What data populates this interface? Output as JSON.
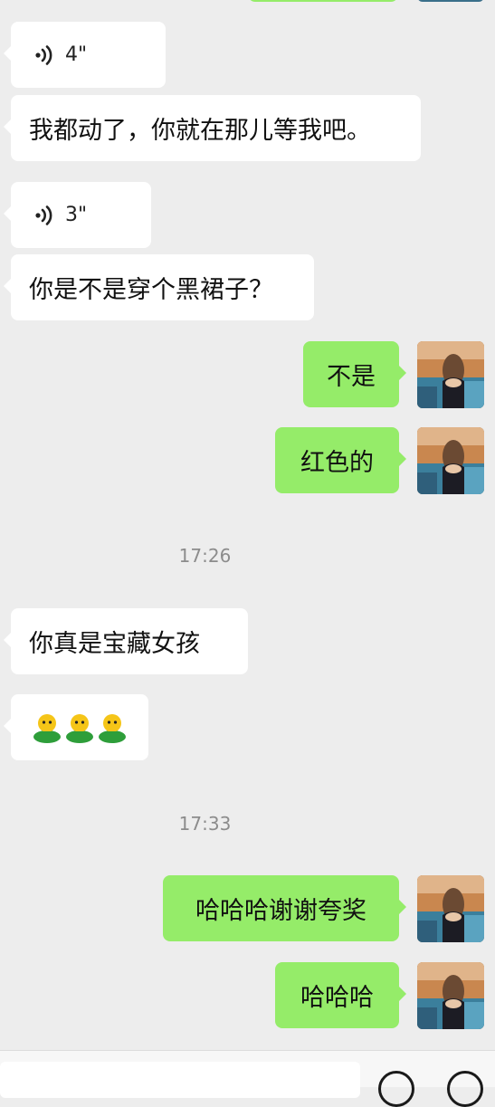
{
  "messages": [
    {
      "kind": "voice",
      "side": "in",
      "duration": "4\""
    },
    {
      "kind": "text",
      "side": "in",
      "text": "我都动了，你就在那儿等我吧。"
    },
    {
      "kind": "voice",
      "side": "in",
      "duration": "3\""
    },
    {
      "kind": "text",
      "side": "in",
      "text": "你是不是穿个黑裙子？"
    },
    {
      "kind": "text",
      "side": "out",
      "text": "不是"
    },
    {
      "kind": "text",
      "side": "out",
      "text": "红色的"
    },
    {
      "kind": "time",
      "text": "17:26"
    },
    {
      "kind": "text",
      "side": "in",
      "text": "你真是宝藏女孩"
    },
    {
      "kind": "emoji",
      "side": "in",
      "count": 3
    },
    {
      "kind": "time",
      "text": "17:33"
    },
    {
      "kind": "text",
      "side": "out",
      "text": "哈哈哈谢谢夸奖"
    },
    {
      "kind": "text",
      "side": "out",
      "text": "哈哈哈"
    }
  ],
  "colors": {
    "background": "#ededed",
    "incoming_bubble": "#ffffff",
    "outgoing_bubble": "#95ec69",
    "timestamp": "#8c8c8c"
  },
  "icons": {
    "voice": "voice-wave-icon",
    "emoji": "green-blob-emoji-icon",
    "input_emoji": "smiley-icon",
    "input_plus": "plus-circle-icon"
  }
}
